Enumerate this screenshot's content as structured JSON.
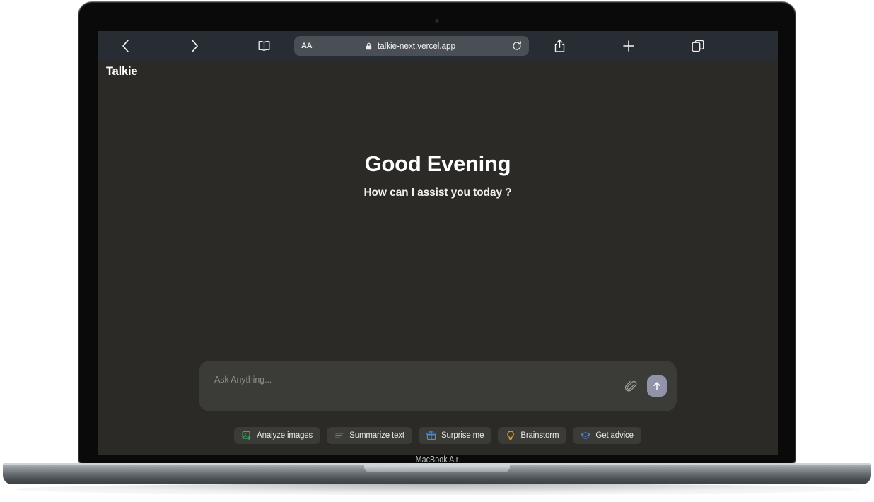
{
  "device": {
    "model_label": "MacBook Air"
  },
  "browser": {
    "back_icon": "chevron-left-icon",
    "forward_icon": "chevron-right-icon",
    "bookmarks_icon": "book-icon",
    "share_icon": "share-icon",
    "new_tab_icon": "plus-icon",
    "tabs_icon": "tabs-icon",
    "url_bar": {
      "text_size_label": "AA",
      "lock_icon": "lock-icon",
      "url": "talkie-next.vercel.app",
      "reload_icon": "reload-icon"
    }
  },
  "app": {
    "brand": "Talkie",
    "hero": {
      "title": "Good Evening",
      "subtitle": "How can I assist you today ?"
    },
    "composer": {
      "placeholder": "Ask Anything...",
      "value": "",
      "attach_icon": "paperclip-icon",
      "send_icon": "arrow-up-icon",
      "send_button_color": "#9193a8"
    },
    "suggestions": [
      {
        "label": "Analyze images",
        "icon": "image-plus-icon",
        "color": "#3fa864"
      },
      {
        "label": "Summarize text",
        "icon": "text-lines-icon",
        "color": "#d4813b"
      },
      {
        "label": "Surprise me",
        "icon": "gift-icon",
        "color": "#4a90e2"
      },
      {
        "label": "Brainstorm",
        "icon": "lightbulb-icon",
        "color": "#e0a72e"
      },
      {
        "label": "Get advice",
        "icon": "graduation-cap-icon",
        "color": "#4a90e2"
      }
    ]
  },
  "theme": {
    "page_background": "#2b2a26",
    "toolbar_background": "#282d33",
    "surface": "#3b3b38",
    "text_primary": "#ffffff",
    "text_muted": "#8e8d88"
  }
}
